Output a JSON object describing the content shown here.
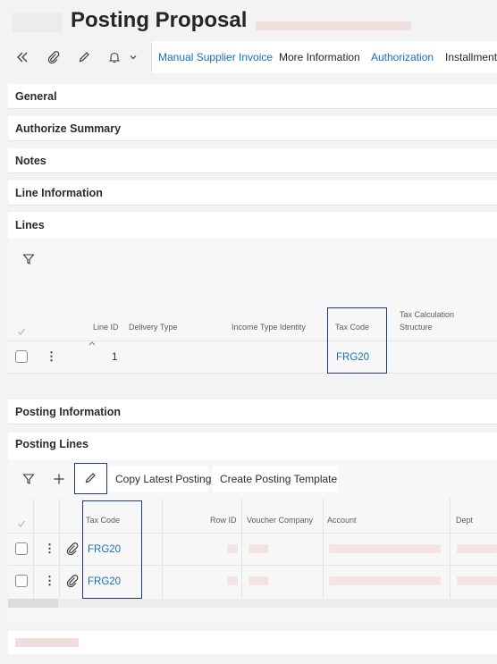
{
  "page": {
    "title": "Posting Proposal"
  },
  "toolbar": {
    "nav": [
      "Manual Supplier Invoice",
      "More Information",
      "Authorization",
      "Installment"
    ]
  },
  "sections": {
    "general": "General",
    "authorize_summary": "Authorize Summary",
    "notes": "Notes",
    "line_information": "Line Information",
    "lines": "Lines",
    "posting_information": "Posting Information",
    "posting_lines": "Posting Lines"
  },
  "lines_table": {
    "headers": {
      "line_id": "Line ID",
      "delivery_type": "Delivery Type",
      "income_type_identity": "Income Type Identity",
      "tax_code": "Tax Code",
      "tax_calc_1": "Tax Calculation",
      "tax_calc_2": "Structure"
    },
    "rows": [
      {
        "line_id": "1",
        "tax_code": "FRG20"
      }
    ]
  },
  "posting_lines": {
    "buttons": {
      "copy_latest": "Copy Latest Posting",
      "create_template": "Create Posting Template"
    },
    "headers": {
      "tax_code": "Tax Code",
      "row_id": "Row ID",
      "voucher_company": "Voucher Company",
      "account": "Account",
      "dept": "Dept"
    },
    "rows": [
      {
        "tax_code": "FRG20"
      },
      {
        "tax_code": "FRG20"
      }
    ]
  },
  "colors": {
    "link": "#1670b8",
    "highlight_box": "#1e3c78",
    "redacted": "#f3e3e3"
  },
  "icons": [
    "double-chevron-left-icon",
    "paperclip-icon",
    "pencil-icon",
    "bell-icon",
    "chevron-down-icon",
    "filter-icon",
    "plus-icon",
    "checkmark-icon",
    "sort-arrow-icon",
    "kebab-icon"
  ]
}
